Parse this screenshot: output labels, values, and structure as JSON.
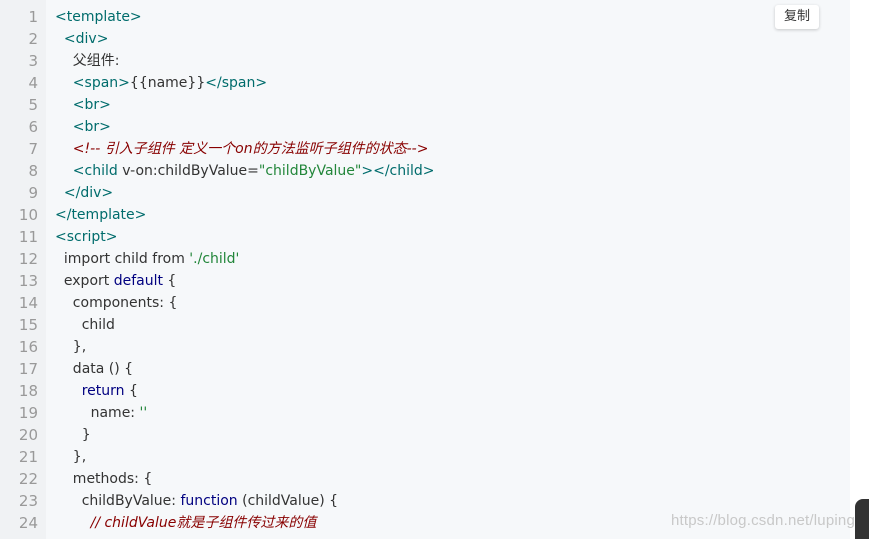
{
  "toolbar": {
    "copy_label": "复制"
  },
  "watermark": "https://blog.csdn.net/luping",
  "code_lines": [
    {
      "n": "1",
      "segments": [
        {
          "t": "<template>",
          "c": "tag"
        }
      ]
    },
    {
      "n": "2",
      "segments": [
        {
          "t": "  <div>",
          "c": "tag"
        }
      ]
    },
    {
      "n": "3",
      "segments": [
        {
          "t": "    父组件:",
          "c": ""
        }
      ]
    },
    {
      "n": "4",
      "segments": [
        {
          "t": "    <span>",
          "c": "tag"
        },
        {
          "t": "{{name}}",
          "c": ""
        },
        {
          "t": "</span>",
          "c": "tag"
        }
      ]
    },
    {
      "n": "5",
      "segments": [
        {
          "t": "    <br>",
          "c": "tag"
        }
      ]
    },
    {
      "n": "6",
      "segments": [
        {
          "t": "    <br>",
          "c": "tag"
        }
      ]
    },
    {
      "n": "7",
      "segments": [
        {
          "t": "    <!-- 引入子组件 定义一个on的方法监听子组件的状态-->",
          "c": "cm"
        }
      ]
    },
    {
      "n": "8",
      "segments": [
        {
          "t": "    <child ",
          "c": "tag"
        },
        {
          "t": "v-on:childByValue=",
          "c": ""
        },
        {
          "t": "\"childByValue\"",
          "c": "str"
        },
        {
          "t": "></child>",
          "c": "tag"
        }
      ]
    },
    {
      "n": "9",
      "segments": [
        {
          "t": "  </div>",
          "c": "tag"
        }
      ]
    },
    {
      "n": "10",
      "segments": [
        {
          "t": "</template>",
          "c": "tag"
        }
      ]
    },
    {
      "n": "11",
      "segments": [
        {
          "t": "<script>",
          "c": "tag"
        }
      ]
    },
    {
      "n": "12",
      "segments": [
        {
          "t": "  import child from ",
          "c": ""
        },
        {
          "t": "'./child'",
          "c": "str"
        }
      ]
    },
    {
      "n": "13",
      "segments": [
        {
          "t": "  export ",
          "c": ""
        },
        {
          "t": "default",
          "c": "kw"
        },
        {
          "t": " {",
          "c": ""
        }
      ]
    },
    {
      "n": "14",
      "segments": [
        {
          "t": "    components: {",
          "c": ""
        }
      ]
    },
    {
      "n": "15",
      "segments": [
        {
          "t": "      child",
          "c": ""
        }
      ]
    },
    {
      "n": "16",
      "segments": [
        {
          "t": "    },",
          "c": ""
        }
      ]
    },
    {
      "n": "17",
      "segments": [
        {
          "t": "    data () {",
          "c": ""
        }
      ]
    },
    {
      "n": "18",
      "segments": [
        {
          "t": "      ",
          "c": ""
        },
        {
          "t": "return",
          "c": "kw"
        },
        {
          "t": " {",
          "c": ""
        }
      ]
    },
    {
      "n": "19",
      "segments": [
        {
          "t": "        name: ",
          "c": ""
        },
        {
          "t": "''",
          "c": "str"
        }
      ]
    },
    {
      "n": "20",
      "segments": [
        {
          "t": "      }",
          "c": ""
        }
      ]
    },
    {
      "n": "21",
      "segments": [
        {
          "t": "    },",
          "c": ""
        }
      ]
    },
    {
      "n": "22",
      "segments": [
        {
          "t": "    methods: {",
          "c": ""
        }
      ]
    },
    {
      "n": "23",
      "segments": [
        {
          "t": "      childByValue: ",
          "c": ""
        },
        {
          "t": "function",
          "c": "kw"
        },
        {
          "t": " (childValue) {",
          "c": ""
        }
      ]
    },
    {
      "n": "24",
      "segments": [
        {
          "t": "        // childValue就是子组件传过来的值",
          "c": "cm"
        }
      ]
    }
  ],
  "colors": {
    "background": "#f6f8fa",
    "tag": "#006c6c",
    "string": "#22863a",
    "keyword": "#000080",
    "comment": "#880000"
  }
}
